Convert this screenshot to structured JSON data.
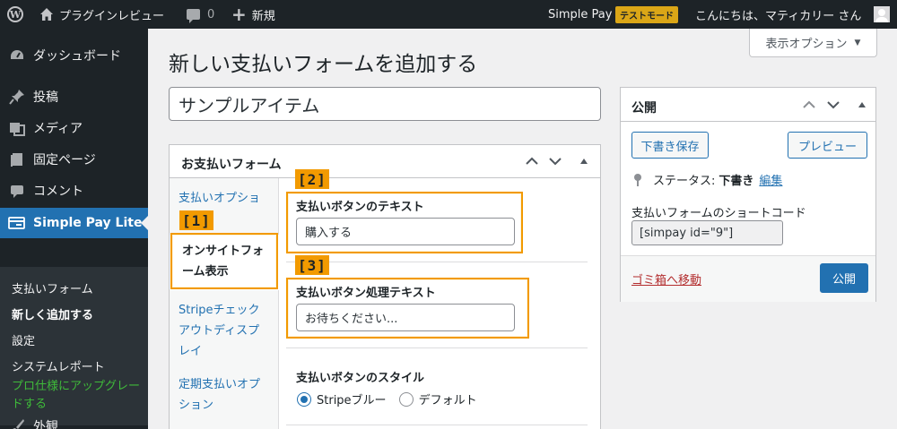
{
  "adminbar": {
    "site_name": "プラグインレビュー",
    "comments_count": "0",
    "new_label": "新規",
    "simplepay_label": "Simple Pay",
    "test_mode_label": "テストモード",
    "greeting": "こんにちは、マティカリー さん"
  },
  "sidebar": {
    "items": [
      {
        "label": "ダッシュボード",
        "icon": "dashboard-icon"
      },
      {
        "label": "投稿",
        "icon": "pin-icon"
      },
      {
        "label": "メディア",
        "icon": "media-icon"
      },
      {
        "label": "固定ページ",
        "icon": "page-icon"
      },
      {
        "label": "コメント",
        "icon": "comment-icon"
      },
      {
        "label": "Simple Pay Lite",
        "icon": "simplepay-icon"
      }
    ],
    "submenu": [
      {
        "label": "支払いフォーム"
      },
      {
        "label": "新しく追加する"
      },
      {
        "label": "設定"
      },
      {
        "label": "システムレポート"
      },
      {
        "label": "プロ仕様にアップグレードする"
      }
    ],
    "appearance_label": "外観"
  },
  "screen_options": "表示オプション",
  "page_title": "新しい支払いフォームを追加する",
  "title_field_value": "サンプルアイテム",
  "form_box": {
    "title": "お支払いフォーム",
    "tabs": [
      "支払いオプション",
      "オンサイトフォーム表示",
      "Stripeチェックアウトディスプレイ",
      "定期支払いオプション"
    ],
    "fields": {
      "button_text_label": "支払いボタンのテキスト",
      "button_text_value": "購入する",
      "processing_text_label": "支払いボタン処理テキスト",
      "processing_text_value": "お待ちください...",
      "style_label": "支払いボタンのスタイル",
      "style_option_stripe": "Stripeブルー",
      "style_option_default": "デフォルト"
    },
    "style_selected": "Stripeブルー"
  },
  "highlights": {
    "h1": "[1]",
    "h2": "[2]",
    "h3": "[3]"
  },
  "publish_box": {
    "title": "公開",
    "save_draft": "下書き保存",
    "preview": "プレビュー",
    "status_label": "ステータス:",
    "status_value": "下書き",
    "edit_link": "編集",
    "shortcode_label": "支払いフォームのショートコード",
    "shortcode_value": "[simpay id=\"9\"]",
    "trash_link": "ゴミ箱へ移動",
    "publish": "公開"
  },
  "colors": {
    "accent": "#2271b1",
    "adminbar": "#1d2327",
    "highlight": "#f29a00",
    "test_mode": "#dba617",
    "upgrade": "#3fba3a"
  }
}
